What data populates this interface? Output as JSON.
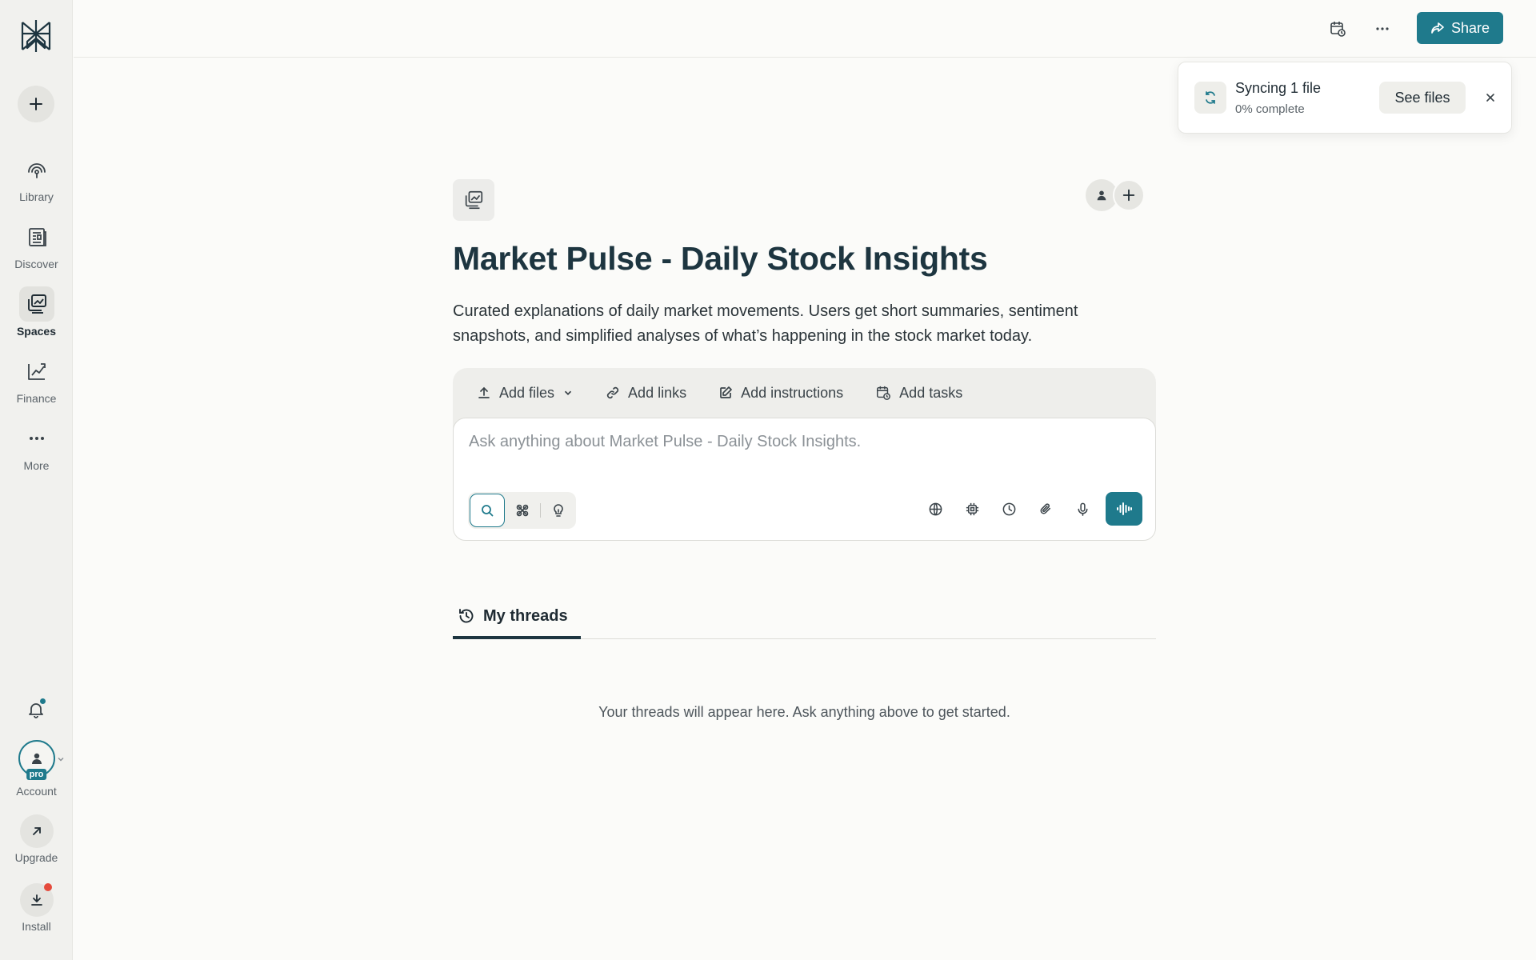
{
  "sidebar": {
    "items": [
      {
        "label": "Library",
        "icon": "library-icon"
      },
      {
        "label": "Discover",
        "icon": "discover-icon"
      },
      {
        "label": "Spaces",
        "icon": "spaces-icon"
      },
      {
        "label": "Finance",
        "icon": "finance-icon"
      },
      {
        "label": "More",
        "icon": "more-icon"
      }
    ],
    "active_item": "Spaces",
    "account_label": "Account",
    "pro_badge": "pro",
    "upgrade_label": "Upgrade",
    "install_label": "Install"
  },
  "topbar": {
    "share_label": "Share"
  },
  "toast": {
    "title": "Syncing 1 file",
    "progress_text": "0% complete",
    "see_files_label": "See files"
  },
  "space": {
    "title": "Market Pulse - Daily Stock Insights",
    "description": "Curated explanations of daily market movements. Users get short summaries, sentiment snapshots, and simplified analyses of what’s happening in the stock market today."
  },
  "composer": {
    "actions": [
      {
        "label": "Add files"
      },
      {
        "label": "Add links"
      },
      {
        "label": "Add instructions"
      },
      {
        "label": "Add tasks"
      }
    ],
    "placeholder": "Ask anything about Market Pulse - Daily Stock Insights."
  },
  "threads": {
    "tab_label": "My threads",
    "empty_text": "Your threads will appear here. Ask anything above to get started."
  },
  "colors": {
    "accent": "#1f7a8c",
    "title": "#1d3540",
    "notification_dot": "#e54b3c"
  }
}
